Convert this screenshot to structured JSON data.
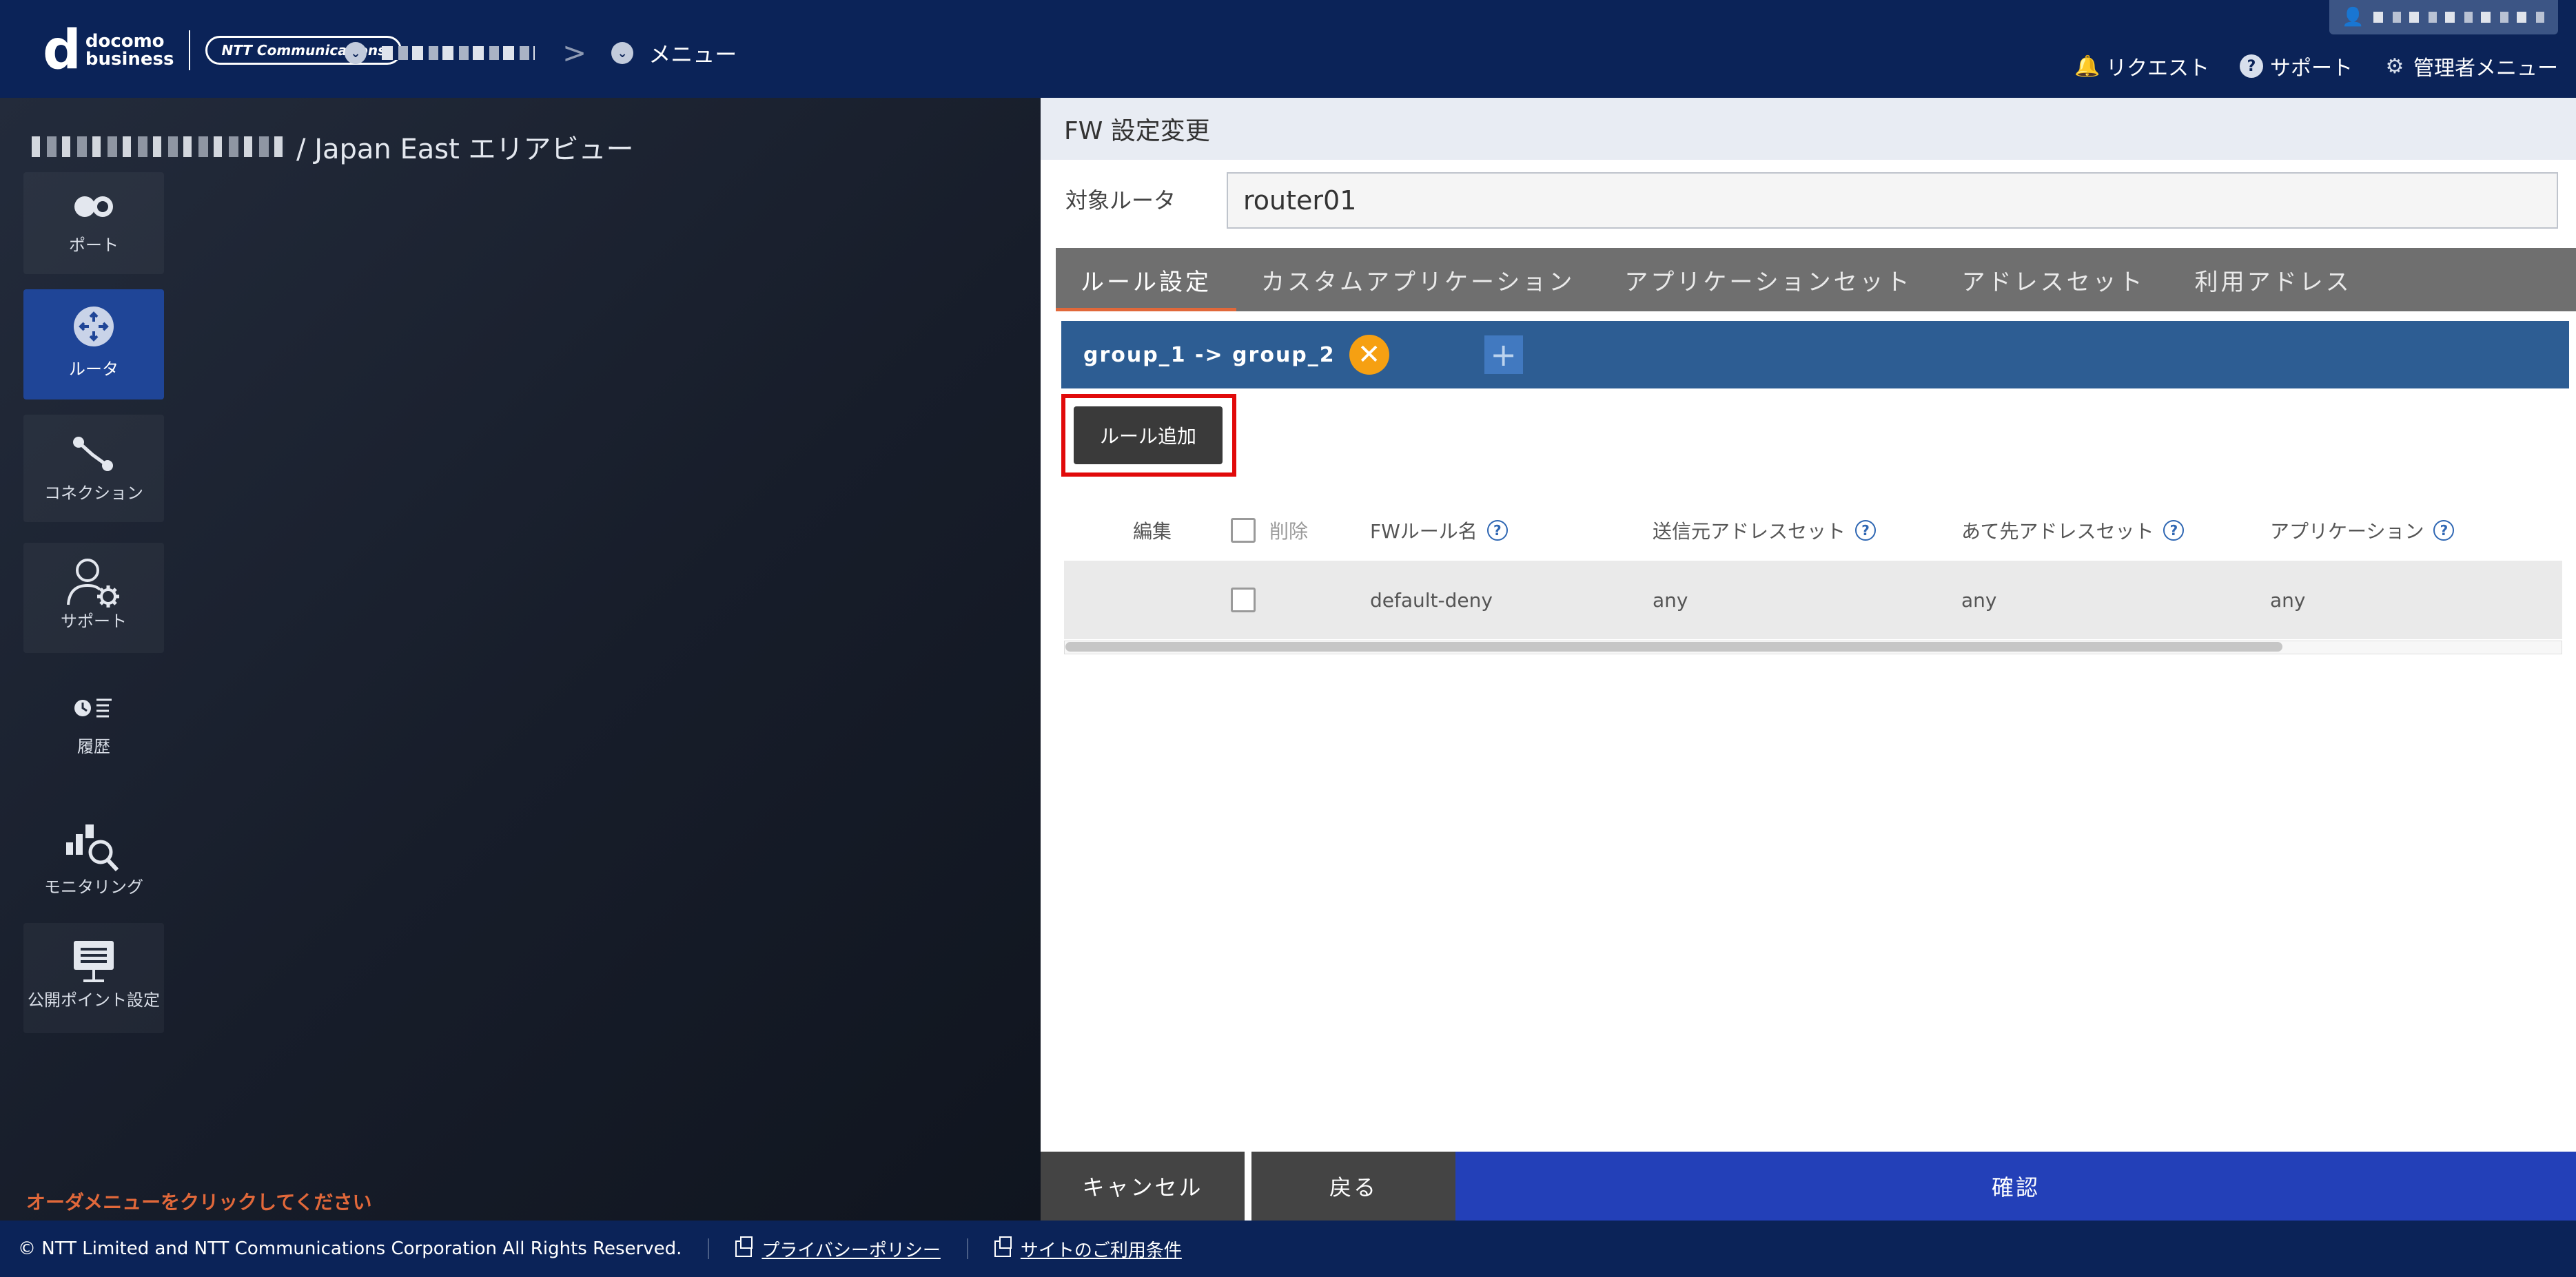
{
  "header": {
    "logo": {
      "d": "d",
      "line1": "docomo",
      "line2": "business",
      "ntt": "NTT Communications"
    },
    "breadcrumb_sep": ">",
    "breadcrumb_menu": "メニュー",
    "links": {
      "request": "リクエスト",
      "support": "サポート",
      "admin_menu": "管理者メニュー"
    }
  },
  "left": {
    "area_title": "/ Japan East エリアビュー",
    "sidebar": {
      "port": "ポート",
      "router": "ルータ",
      "connection": "コネクション",
      "support": "サポート",
      "history": "履歴",
      "monitoring": "モニタリング",
      "public_point": "公開ポイント設定"
    },
    "orders_message": "オーダメニューをクリックしてください"
  },
  "panel": {
    "title": "FW 設定変更",
    "router_label": "対象ルータ",
    "router_value": "router01",
    "tabs": {
      "rule": "ルール設定",
      "custom_app": "カスタムアプリケーション",
      "app_set": "アプリケーションセット",
      "address_set": "アドレスセット",
      "used_address": "利用アドレス"
    },
    "group_tab": {
      "label": "group_1 -> group_2",
      "close": "✕",
      "add": "+"
    },
    "add_rule": "ルール追加",
    "columns": {
      "edit": "編集",
      "delete": "削除",
      "fw_rule_name": "FWルール名",
      "source_address_set": "送信元アドレスセット",
      "dest_address_set": "あて先アドレスセット",
      "application": "アプリケーション"
    },
    "rows": [
      {
        "fw_rule_name": "default-deny",
        "source": "any",
        "dest": "any",
        "application": "any"
      }
    ],
    "buttons": {
      "cancel": "キャンセル",
      "back": "戻る",
      "confirm": "確認"
    }
  },
  "footer": {
    "copyright": "© NTT Limited and NTT Communications Corporation All Rights Reserved.",
    "privacy": "プライバシーポリシー",
    "terms": "サイトのご利用条件"
  },
  "colors": {
    "header": "#0b2358",
    "active_side": "#1f4597",
    "confirm": "#2340b8",
    "accent": "#e1683a",
    "highlight": "#e10a0a",
    "group_tab": "#2d5d93"
  }
}
